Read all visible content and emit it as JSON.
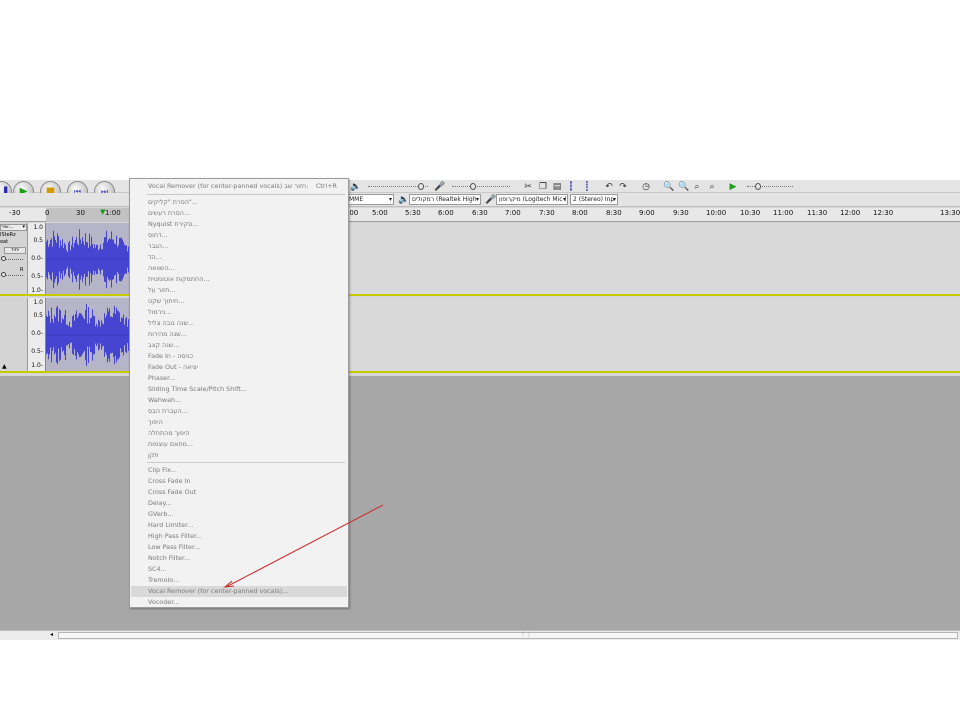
{
  "menu": {
    "repeat": {
      "label": "Vocal Remover (for center-panned vocals) חזור שב:",
      "shortcut": "Ctrl+R"
    },
    "group1": [
      "הסרת \"קליקים\"...",
      "הסרת רעשים...",
      "Nyquist סקירת...",
      "דחוס...",
      "הגבר...",
      "הד...",
      "השוואה...",
      "החתמקות אוטומטית...",
      "חזור על...",
      "חיתוך שקט...",
      "נירמול...",
      "שנה גובה צליל...",
      "שנה מהירות...",
      "שנה קצב...",
      "Fade In - כניסה",
      "Fade Out - יציאה",
      "Phaser...",
      "Sliding Time Scale/Pitch Shift...",
      "Wahwah...",
      "העברת הבס...",
      "היפוך",
      "היפוך מהתחלה",
      "מתאם עוצמות...",
      "תקן"
    ],
    "group2": [
      "Clip Fix...",
      "Cross Fade In",
      "Cross Fade Out",
      "Delay...",
      "GVerb...",
      "Hard Limiter...",
      "High Pass Filter...",
      "Low Pass Filter...",
      "Notch Filter...",
      "SC4...",
      "Tremolo...",
      "Vocal Remover (for center-panned vocals)...",
      "Vocoder..."
    ],
    "highlighted": "Vocal Remover (for center-panned vocals)..."
  },
  "ruler": {
    "left_ticks": [
      "-30",
      "0",
      "30",
      "1:00"
    ],
    "ticks": [
      "5:00",
      "5:30",
      "6:00",
      "6:30",
      "7:00",
      "7:30",
      "8:00",
      "8:30",
      "9:00",
      "9:30",
      "10:00",
      "10:30",
      "11:00",
      "11:30",
      "12:00",
      "12:30",
      "13:30"
    ],
    "partial_tick": ":00"
  },
  "toolbar": {
    "audio_host": "MME",
    "output_device": "רמקולים (Realtek High",
    "input_device": "מיקרופון (Logitech Mic (",
    "channels": "2 (Stereo) Inp"
  },
  "tracks": {
    "scale_labels": [
      "1.0",
      "0.5",
      "0.0-",
      "0.5-",
      "1.0-"
    ],
    "name": "שיר...",
    "info1": "ISteRz",
    "info2": "oat",
    "mute_label": "יחיד",
    "pan_right": "R"
  },
  "annotation": {
    "color": "#cc2b2b"
  }
}
